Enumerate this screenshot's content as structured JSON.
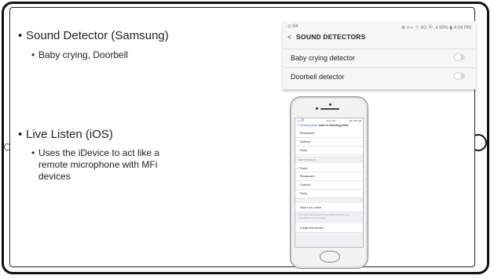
{
  "slide": {
    "bullets": [
      {
        "text": "Sound Detector (Samsung)",
        "sub": [
          "Baby crying, Doorbell"
        ]
      },
      {
        "text": "Live Listen (iOS)",
        "sub": [
          "Uses the iDevice to act like a",
          "remote microphone with MFi",
          "devices"
        ]
      }
    ]
  },
  "samsung_screen": {
    "status_left": "◎ 84",
    "status_right": "⚙ ≡ ◐ ☉ 4G ⦿ .ıl 99% ▮ 4:04 PM",
    "back_icon": "chevron-left",
    "header": "SOUND DETECTORS",
    "rows": [
      {
        "label": "Baby crying detector",
        "toggle": "off"
      },
      {
        "label": "Doorbell detector",
        "toggle": "off"
      }
    ]
  },
  "iphone_screen": {
    "status_left": "••••• ≣",
    "status_center": "9:41 AM",
    "status_right": "✱ 100% ▬",
    "back_label": "Hearing Aids",
    "title": "John's Hearing Aids",
    "rows_top": [
      "Restaurant",
      "Outdoor",
      "Party"
    ],
    "section_label": "LEFT PRESETS",
    "rows_presets": [
      {
        "label": "✓ Basic",
        "checked": true
      },
      {
        "label": "Restaurant",
        "checked": false
      },
      {
        "label": "Outdoor",
        "checked": false
      },
      {
        "label": "Party",
        "checked": false
      }
    ],
    "live_listen": "Start Live Listen",
    "live_listen_note": "Live Listen sends audio to your hearing aid from the microphone on your iPhone.",
    "forget": "Forget this device"
  },
  "colors": {
    "link": "#2a6bd6",
    "frame": "#111111"
  }
}
